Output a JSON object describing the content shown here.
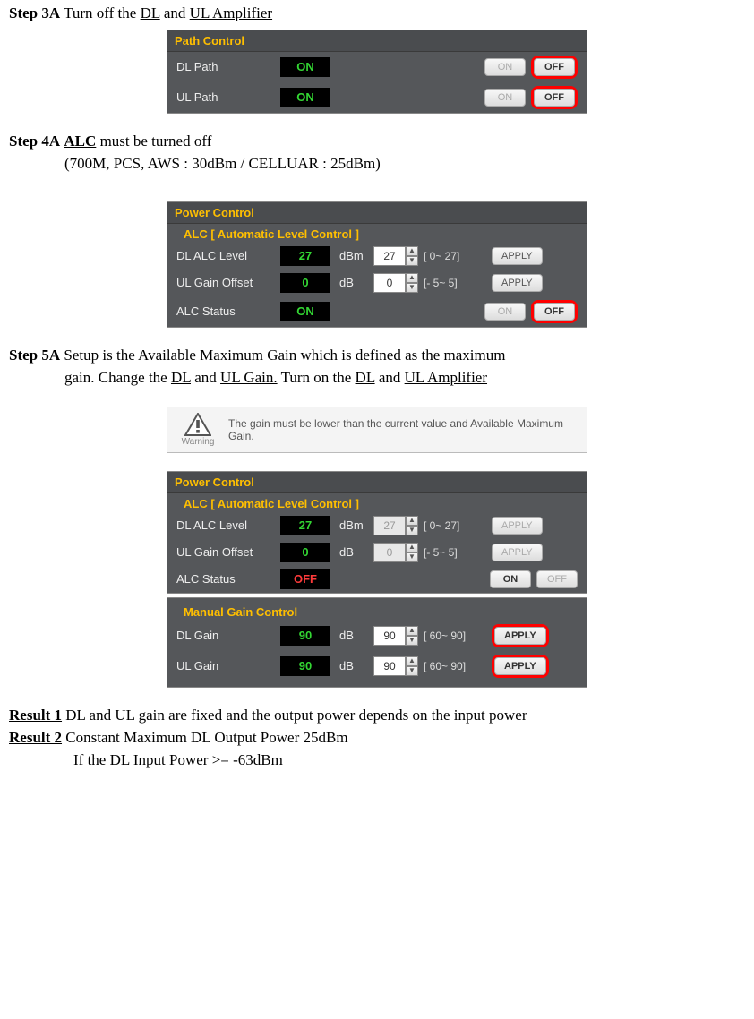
{
  "step3": {
    "label": "Step 3A",
    "text_before": " Turn off the ",
    "dl": "DL",
    "and": " and ",
    "ul_amp": "UL Amplifier"
  },
  "path_control": {
    "title": "Path Control",
    "rows": [
      {
        "label": "DL Path",
        "value": "ON",
        "on": "ON",
        "off": "OFF"
      },
      {
        "label": "UL Path",
        "value": "ON",
        "on": "ON",
        "off": "OFF"
      }
    ]
  },
  "step4": {
    "label": "Step 4A",
    "alc": "ALC",
    "text": " must be turned off",
    "sub": "(700M, PCS, AWS : 30dBm / CELLUAR : 25dBm)"
  },
  "power_control_1": {
    "title": "Power Control",
    "subtitle": "ALC [ Automatic Level Control ]",
    "rows": {
      "alc_level": {
        "label": "DL ALC Level",
        "value": "27",
        "unit": "dBm",
        "input": "27",
        "range": "[ 0~ 27]",
        "apply": "APPLY"
      },
      "ul_gain": {
        "label": "UL Gain Offset",
        "value": "0",
        "unit": "dB",
        "input": "0",
        "range": "[- 5~  5]",
        "apply": "APPLY"
      },
      "alc_status": {
        "label": "ALC Status",
        "value": "ON",
        "on": "ON",
        "off": "OFF"
      }
    }
  },
  "step5": {
    "label": "Step 5A",
    "line1": " Setup is the Available Maximum Gain which is defined as the maximum",
    "line2a": "gain. Change the ",
    "dl": "DL",
    "and1": " and ",
    "ul_gain": "UL Gain.",
    "line2b": " Turn on the ",
    "dl2": "DL",
    "and2": " and ",
    "ul_amp": "UL Amplifier"
  },
  "warning": {
    "label": "Warning",
    "text": "The gain must be lower than the current value and Available Maximum Gain."
  },
  "power_control_2": {
    "title": "Power Control",
    "subtitle": "ALC [ Automatic Level Control ]",
    "rows": {
      "alc_level": {
        "label": "DL ALC Level",
        "value": "27",
        "unit": "dBm",
        "input": "27",
        "range": "[ 0~ 27]",
        "apply": "APPLY"
      },
      "ul_gain": {
        "label": "UL Gain Offset",
        "value": "0",
        "unit": "dB",
        "input": "0",
        "range": "[- 5~  5]",
        "apply": "APPLY"
      },
      "alc_status": {
        "label": "ALC Status",
        "value": "OFF",
        "on": "ON",
        "off": "OFF"
      }
    }
  },
  "manual_gain": {
    "title": "Manual Gain Control",
    "rows": {
      "dl": {
        "label": "DL Gain",
        "value": "90",
        "unit": "dB",
        "input": "90",
        "range": "[ 60~ 90]",
        "apply": "APPLY"
      },
      "ul": {
        "label": "UL Gain",
        "value": "90",
        "unit": "dB",
        "input": "90",
        "range": "[ 60~ 90]",
        "apply": "APPLY"
      }
    }
  },
  "result1": {
    "label": "Result 1",
    "text": " DL and UL gain are fixed and the output power depends on the input power"
  },
  "result2": {
    "label": "Result 2",
    "line1": " Constant Maximum DL Output Power 25dBm",
    "line2": "If the DL Input Power >= -63dBm"
  }
}
